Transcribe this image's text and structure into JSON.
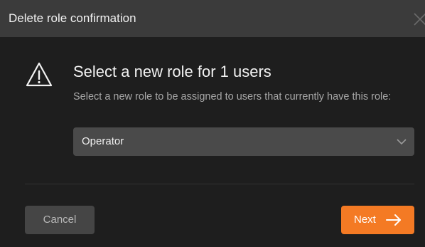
{
  "dialog": {
    "title": "Delete role confirmation",
    "close_icon": "close-icon",
    "warning_icon": "warning-triangle-icon",
    "heading": "Select a new role for 1 users",
    "description": "Select a new role to be assigned to users that currently have this role:",
    "role_select": {
      "selected_value": "Operator",
      "icon": "chevron-down-icon"
    },
    "buttons": {
      "cancel_label": "Cancel",
      "next_label": "Next",
      "next_icon": "arrow-right-icon"
    }
  },
  "colors": {
    "background": "#1e1e1e",
    "titlebar": "#3b3b3b",
    "select_bg": "#4a4a4a",
    "cancel_bg": "#454545",
    "accent": "#f47a24",
    "muted_text": "#a8a8a8"
  }
}
